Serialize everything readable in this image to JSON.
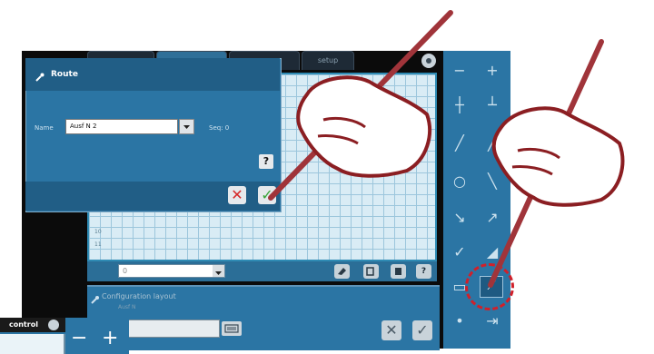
{
  "top_tabs": {
    "setup_label": "setup"
  },
  "route_dialog": {
    "title": "Route",
    "name_label": "Name",
    "name_value": "Ausf N 2",
    "seq_label": "Seq: 0",
    "help_label": "?",
    "cancel_label": "✕",
    "ok_label": "✓"
  },
  "grid": {
    "row_numbers": [
      "10",
      "11"
    ],
    "row_select_value": "0",
    "toolbar_help_label": "?"
  },
  "config_dialog": {
    "title": "Configuration layout",
    "subtitle": "Ausf N",
    "cancel_label": "✕",
    "ok_label": "✓"
  },
  "right_panel": {
    "tools": [
      "minus-icon",
      "plus-icon",
      "pivot-left-icon",
      "pivot-right-icon",
      "pen-icon",
      "pen-edit-icon",
      "circle-icon",
      "curve-icon",
      "arrow-down-icon",
      "arrow-right-icon",
      "check-icon",
      "move-icon",
      "align-icon",
      "draw-line-icon",
      "dot-icon",
      "exit-icon"
    ]
  },
  "inset": {
    "control_label": "control",
    "minus_label": "−",
    "plus_label": "+"
  },
  "colors": {
    "panel_blue": "#2b75a4",
    "header_blue": "#215e86",
    "grid_bg": "#d9ecf5",
    "annotation_red": "#d0202a",
    "hand_outline": "#8b1e22",
    "pen": "#a0343a"
  }
}
